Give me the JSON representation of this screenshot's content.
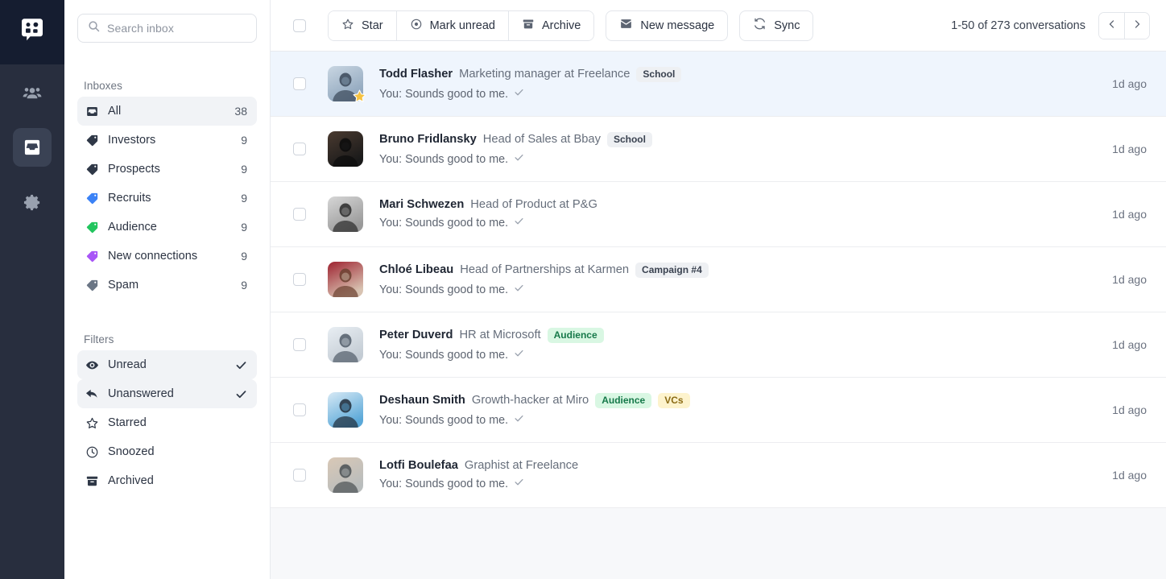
{
  "rail": {
    "logo_icon": "app-logo-icon",
    "items": [
      {
        "icon": "people-icon",
        "name": "contacts",
        "active": false
      },
      {
        "icon": "inbox-icon",
        "name": "inbox",
        "active": true
      },
      {
        "icon": "gear-icon",
        "name": "settings",
        "active": false
      }
    ]
  },
  "sidebar": {
    "search": {
      "placeholder": "Search inbox",
      "value": "",
      "icon": "search-icon"
    },
    "inboxes_title": "Inboxes",
    "inboxes": [
      {
        "label": "All",
        "count": "38",
        "icon": "inbox-icon",
        "color": "#2f3847",
        "active": true
      },
      {
        "label": "Investors",
        "count": "9",
        "icon": "tag-icon",
        "color": "#2f3847",
        "active": false
      },
      {
        "label": "Prospects",
        "count": "9",
        "icon": "tag-icon",
        "color": "#2f3847",
        "active": false
      },
      {
        "label": "Recruits",
        "count": "9",
        "icon": "tag-icon",
        "color": "#3b82f6",
        "active": false
      },
      {
        "label": "Audience",
        "count": "9",
        "icon": "tag-icon",
        "color": "#22c55e",
        "active": false
      },
      {
        "label": "New connections",
        "count": "9",
        "icon": "tag-icon",
        "color": "#a855f7",
        "active": false
      },
      {
        "label": "Spam",
        "count": "9",
        "icon": "tag-icon",
        "color": "#6b7685",
        "active": false
      }
    ],
    "filters_title": "Filters",
    "filters": [
      {
        "label": "Unread",
        "icon": "eye-icon",
        "checked": true,
        "active": true
      },
      {
        "label": "Unanswered",
        "icon": "reply-icon",
        "checked": true,
        "active": true
      },
      {
        "label": "Starred",
        "icon": "star-outline-icon",
        "checked": false,
        "active": false
      },
      {
        "label": "Snoozed",
        "icon": "clock-icon",
        "checked": false,
        "active": false
      },
      {
        "label": "Archived",
        "icon": "archive-icon",
        "checked": false,
        "active": false
      }
    ]
  },
  "toolbar": {
    "select_all_checkbox": "",
    "star_label": "Star",
    "mark_unread_label": "Mark unread",
    "archive_label": "Archive",
    "new_message_label": "New message",
    "sync_label": "Sync",
    "pagination_text": "1-50 of 273 conversations",
    "prev_label": "‹",
    "next_label": "›"
  },
  "conversations": [
    {
      "name": "Todd Flasher",
      "title": "Marketing manager at Freelance",
      "tags": [
        {
          "label": "School",
          "style": "gray"
        }
      ],
      "snippet": "You: Sounds good to me.",
      "time": "1d ago",
      "selected": true,
      "starred": true,
      "avatar": "man-leaning-wall"
    },
    {
      "name": "Bruno Fridlansky",
      "title": "Head of Sales at Bbay",
      "tags": [
        {
          "label": "School",
          "style": "gray"
        }
      ],
      "snippet": "You: Sounds good to me.",
      "time": "1d ago",
      "selected": false,
      "starred": false,
      "avatar": "smiling-man-dark"
    },
    {
      "name": "Mari Schwezen",
      "title": "Head of Product at P&G",
      "tags": [],
      "snippet": "You: Sounds good to me.",
      "time": "1d ago",
      "selected": false,
      "starred": false,
      "avatar": "curly-hair-woman-bw"
    },
    {
      "name": "Chloé Libeau",
      "title": "Head of Partnerships at Karmen",
      "tags": [
        {
          "label": "Campaign #4",
          "style": "gray"
        }
      ],
      "snippet": "You: Sounds good to me.",
      "time": "1d ago",
      "selected": false,
      "starred": false,
      "avatar": "woman-red-sweater"
    },
    {
      "name": "Peter Duverd",
      "title": "HR at Microsoft",
      "tags": [
        {
          "label": "Audience",
          "style": "green"
        }
      ],
      "snippet": "You: Sounds good to me.",
      "time": "1d ago",
      "selected": false,
      "starred": false,
      "avatar": "man-glasses-suit"
    },
    {
      "name": "Deshaun Smith",
      "title": "Growth-hacker at Miro",
      "tags": [
        {
          "label": "Audience",
          "style": "green"
        },
        {
          "label": "VCs",
          "style": "yellow"
        }
      ],
      "snippet": "You: Sounds good to me.",
      "time": "1d ago",
      "selected": false,
      "starred": false,
      "avatar": "man-laptop-blue"
    },
    {
      "name": "Lotfi Boulefaa",
      "title": "Graphist at Freelance",
      "tags": [],
      "snippet": "You: Sounds good to me.",
      "time": "1d ago",
      "selected": false,
      "starred": false,
      "avatar": "young-man-gray"
    }
  ],
  "colors": {
    "rail_bg": "#282e3e",
    "rail_logo_bg": "#151d30",
    "rail_active": "#3a4254",
    "row_selected": "#eff5fd",
    "tag_green_bg": "#d9f7e3",
    "tag_green_fg": "#16794a",
    "tag_yellow_bg": "#fdf3cd",
    "tag_yellow_fg": "#8a6a13",
    "tag_gray_bg": "#eef0f3",
    "tag_gray_fg": "#3a4250",
    "star": "#f5c242"
  }
}
